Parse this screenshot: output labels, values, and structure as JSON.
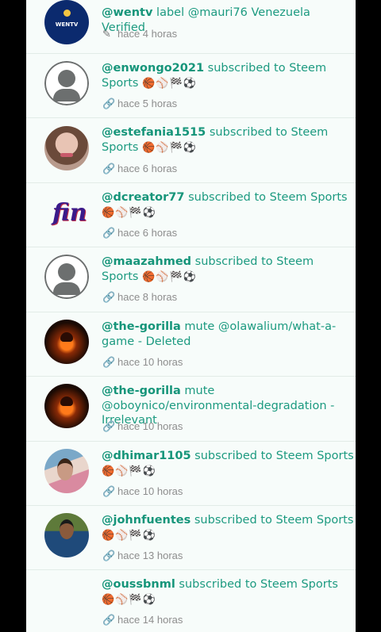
{
  "items": [
    {
      "user": "@wentv",
      "action": " label @mauri76 Venezuela Verified",
      "emoji": "",
      "time": "hace 4 horas",
      "icon": "pencil-icon",
      "avatar": "wentv",
      "avatar_text": "WENTV"
    },
    {
      "user": "@enwongo2021",
      "action": " subscribed to Steem Sports ",
      "emoji": "🏀⚾🏁⚽",
      "time": "hace 5 horas",
      "icon": "link-icon",
      "avatar": "default"
    },
    {
      "user": "@estefania1515",
      "action": " subscribed to Steem Sports ",
      "emoji": "🏀⚾🏁⚽",
      "time": "hace 6 horas",
      "icon": "link-icon",
      "avatar": "woman"
    },
    {
      "user": "@dcreator77",
      "action": " subscribed to Steem Sports ",
      "emoji": "🏀⚾🏁⚽",
      "time": "hace 6 horas",
      "icon": "link-icon",
      "avatar": "logo",
      "avatar_text": "fin"
    },
    {
      "user": "@maazahmed",
      "action": " subscribed to Steem Sports ",
      "emoji": "🏀⚾🏁⚽",
      "time": "hace 8 horas",
      "icon": "link-icon",
      "avatar": "default"
    },
    {
      "user": "@the-gorilla",
      "action": " mute @olawalium/what-a-game - Deleted",
      "emoji": "",
      "time": "hace 10 horas",
      "icon": "link-icon",
      "avatar": "gorilla"
    },
    {
      "user": "@the-gorilla",
      "action": " mute @oboynico/environmental-degradation - Irrelevant",
      "emoji": "",
      "time": "hace 10 horas",
      "icon": "link-icon",
      "avatar": "gorilla"
    },
    {
      "user": "@dhimar1105",
      "action": " subscribed to Steem Sports ",
      "emoji": "🏀⚾🏁⚽",
      "time": "hace 10 horas",
      "icon": "link-icon",
      "avatar": "woman2"
    },
    {
      "user": "@johnfuentes",
      "action": " subscribed to Steem Sports ",
      "emoji": "🏀⚾🏁⚽",
      "time": "hace 13 horas",
      "icon": "link-icon",
      "avatar": "man"
    },
    {
      "user": "@oussbnml",
      "action": " subscribed to Steem Sports ",
      "emoji": "🏀⚾🏁⚽",
      "time": "hace 14 horas",
      "icon": "link-icon",
      "avatar": "none"
    }
  ],
  "icons": {
    "pencil": "✎",
    "link": "🔗"
  }
}
